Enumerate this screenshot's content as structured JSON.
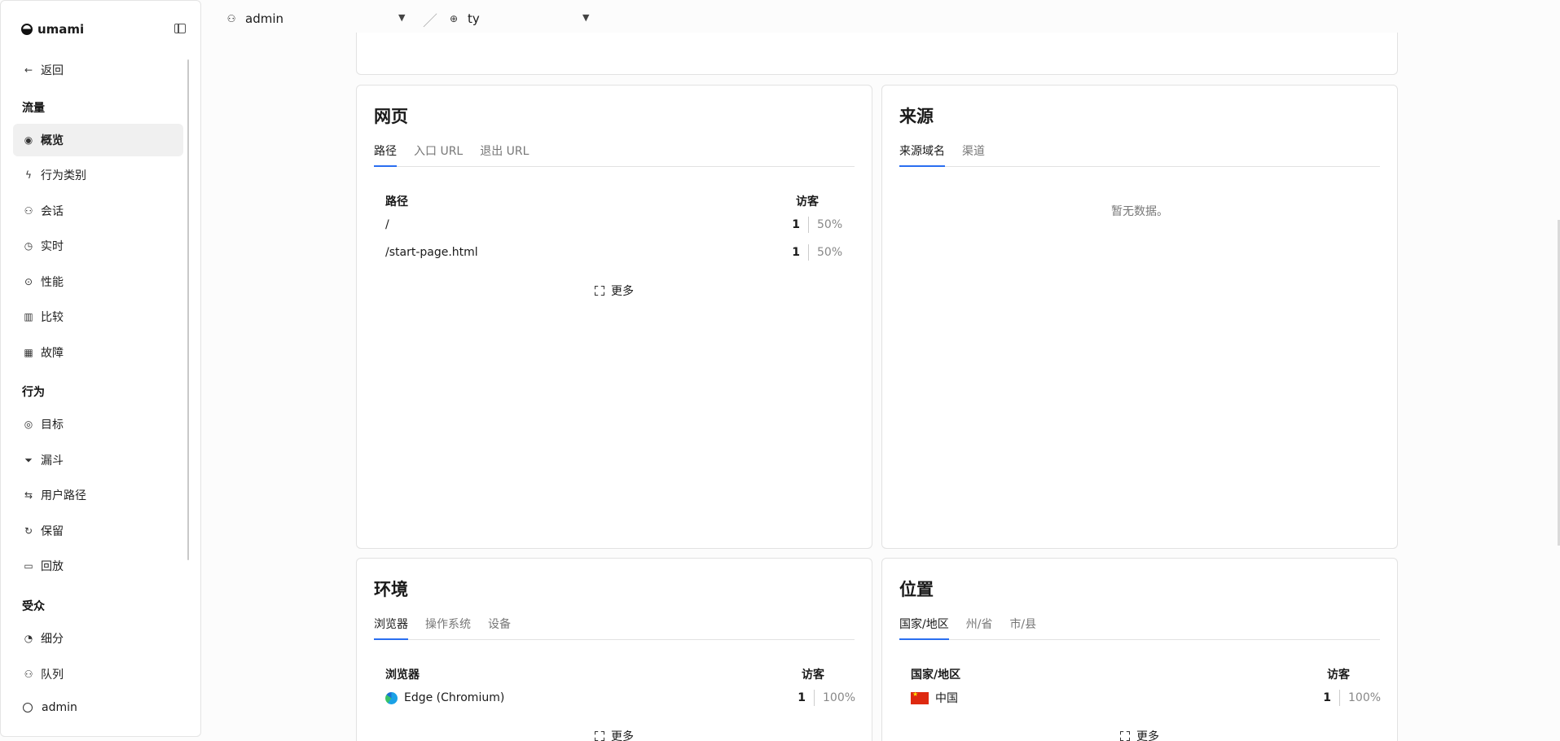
{
  "app": {
    "name": "umami"
  },
  "sidebar": {
    "back_label": "返回",
    "sections": {
      "traffic": "流量",
      "behavior": "行为",
      "audience": "受众"
    },
    "items": [
      {
        "label": "概览",
        "icon": "eye-icon"
      },
      {
        "label": "行为类别",
        "icon": "bolt-icon"
      },
      {
        "label": "会话",
        "icon": "user-icon"
      },
      {
        "label": "实时",
        "icon": "clock-icon"
      },
      {
        "label": "性能",
        "icon": "gauge-icon"
      },
      {
        "label": "比较",
        "icon": "compare-icon"
      },
      {
        "label": "故障",
        "icon": "grid-icon"
      },
      {
        "label": "目标",
        "icon": "target-icon"
      },
      {
        "label": "漏斗",
        "icon": "funnel-icon"
      },
      {
        "label": "用户路径",
        "icon": "path-icon"
      },
      {
        "label": "保留",
        "icon": "retention-icon"
      },
      {
        "label": "回放",
        "icon": "video-icon"
      },
      {
        "label": "细分",
        "icon": "pie-icon"
      },
      {
        "label": "队列",
        "icon": "user-plus-icon"
      }
    ],
    "user": "admin"
  },
  "topbar": {
    "user": "admin",
    "site": "ty",
    "separator": "／"
  },
  "pages_card": {
    "title": "网页",
    "tabs": [
      "路径",
      "入口 URL",
      "退出 URL"
    ],
    "col_label": "路径",
    "col_value": "访客",
    "rows": [
      {
        "label": "/",
        "count": "1",
        "pct": "50%"
      },
      {
        "label": "/start-page.html",
        "count": "1",
        "pct": "50%"
      }
    ],
    "more": "更多"
  },
  "sources_card": {
    "title": "来源",
    "tabs": [
      "来源域名",
      "渠道"
    ],
    "empty": "暂无数据。"
  },
  "env_card": {
    "title": "环境",
    "tabs": [
      "浏览器",
      "操作系统",
      "设备"
    ],
    "col_label": "浏览器",
    "col_value": "访客",
    "rows": [
      {
        "label": "Edge (Chromium)",
        "count": "1",
        "pct": "100%"
      }
    ],
    "more": "更多"
  },
  "location_card": {
    "title": "位置",
    "tabs": [
      "国家/地区",
      "州/省",
      "市/县"
    ],
    "col_label": "国家/地区",
    "col_value": "访客",
    "rows": [
      {
        "label": "中国",
        "count": "1",
        "pct": "100%"
      }
    ],
    "more": "更多"
  }
}
